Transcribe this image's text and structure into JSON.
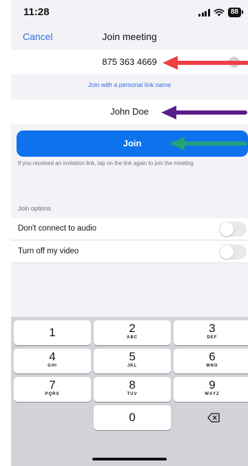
{
  "status": {
    "time": "11:28",
    "battery": "88"
  },
  "nav": {
    "cancel": "Cancel",
    "title": "Join meeting"
  },
  "meeting_id": {
    "value": "875 363 4669"
  },
  "personal_link": "Join with a personal link name",
  "name": {
    "value": "John Doe"
  },
  "join_button": "Join",
  "hint": "If you received an invitation link, tap on the link again to join the meeting",
  "join_options": {
    "label": "Join options",
    "audio": {
      "label": "Don't connect to audio",
      "on": false
    },
    "video": {
      "label": "Turn off my video",
      "on": false
    }
  },
  "keypad": {
    "keys": [
      {
        "digit": "1",
        "letters": ""
      },
      {
        "digit": "2",
        "letters": "ABC"
      },
      {
        "digit": "3",
        "letters": "DEF"
      },
      {
        "digit": "4",
        "letters": "GHI"
      },
      {
        "digit": "5",
        "letters": "JKL"
      },
      {
        "digit": "6",
        "letters": "MNO"
      },
      {
        "digit": "7",
        "letters": "PQRS"
      },
      {
        "digit": "8",
        "letters": "TUV"
      },
      {
        "digit": "9",
        "letters": "WXYZ"
      },
      {
        "digit": "0",
        "letters": ""
      }
    ]
  },
  "colors": {
    "accent": "#0e72ed",
    "arrow_red": "#ee3f44",
    "arrow_purple": "#5a1e8c",
    "arrow_teal": "#1fa37a"
  }
}
